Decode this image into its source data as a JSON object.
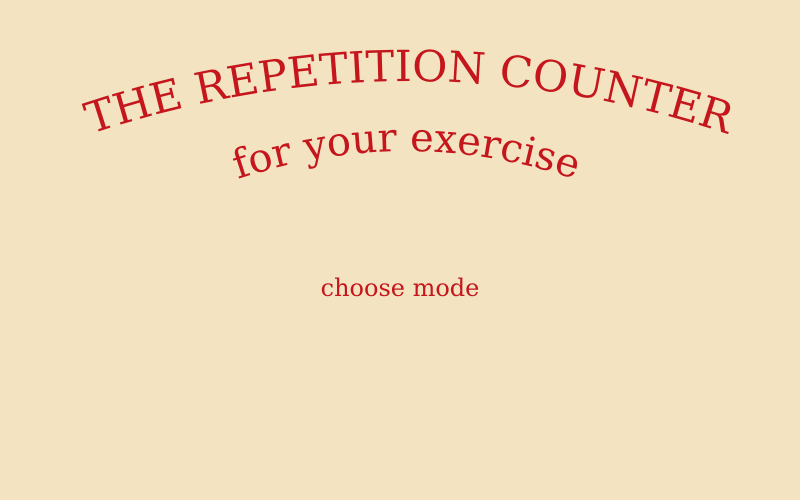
{
  "app": {
    "title": "THE REPETITION COUNTER",
    "subtitle": "for your exercise"
  },
  "menu": {
    "choose_mode_label": "choose mode"
  },
  "colors": {
    "background": "#f4e3c1",
    "accent": "#c4161c"
  }
}
